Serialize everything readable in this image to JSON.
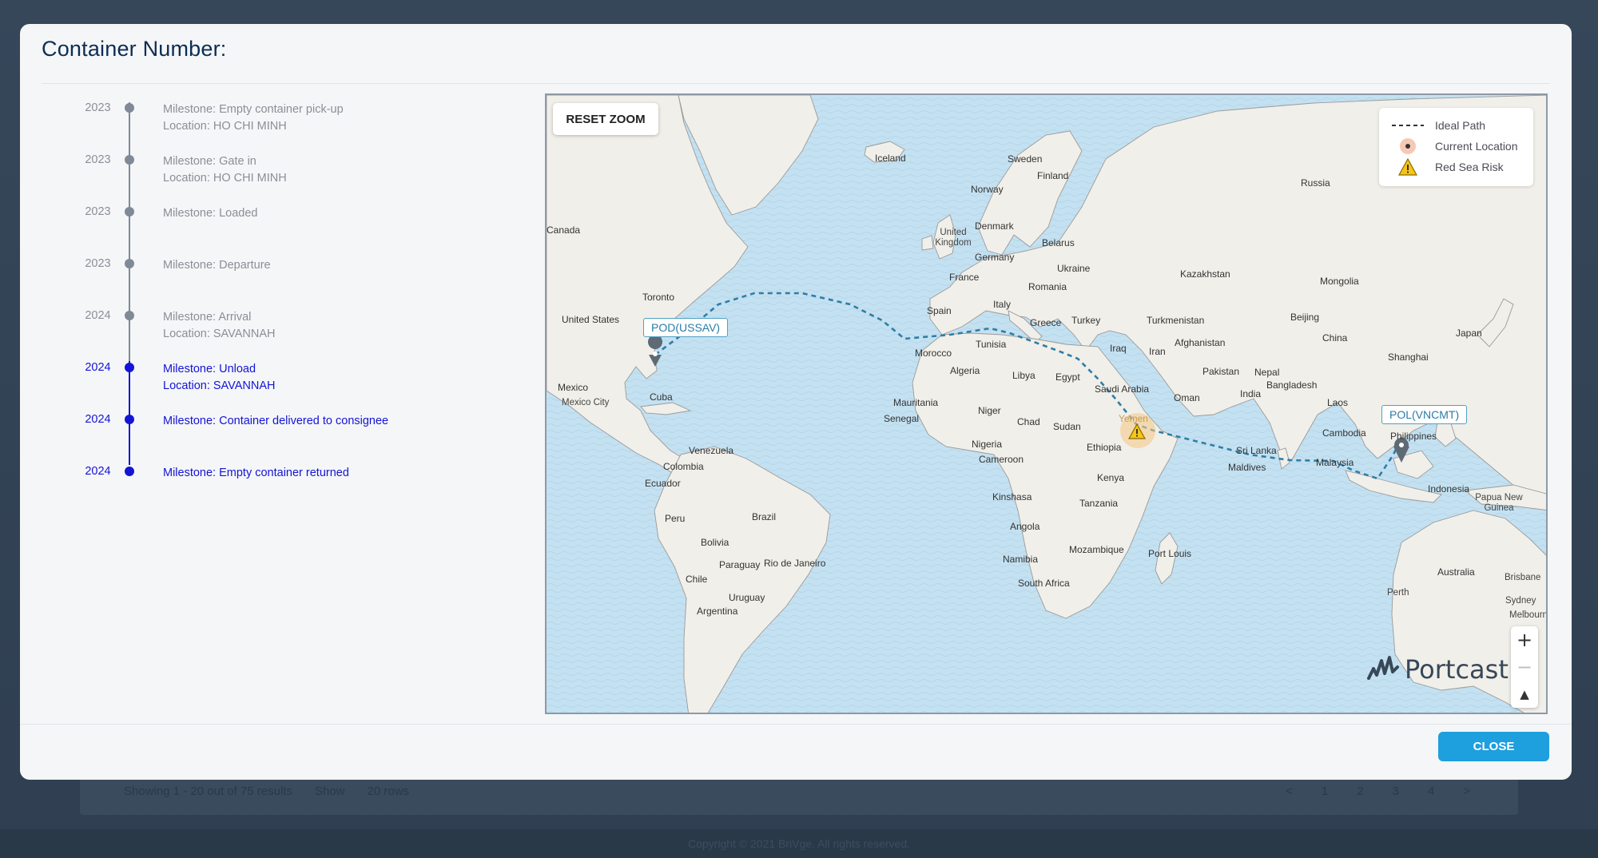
{
  "background": {
    "pager_text": "Showing 1 - 20 out of 75 results",
    "show_label": "Show",
    "rows_value": "20 rows",
    "pages": [
      "<",
      "1",
      "2",
      "3",
      "4",
      ">"
    ],
    "copyright": "Copyright © 2021 BriVge. All rights reserved."
  },
  "modal": {
    "title": "Container Number:",
    "close_label": "CLOSE"
  },
  "timeline": [
    {
      "year": "2023",
      "milestone": "Milestone: Empty container pick-up",
      "location": "Location: HO CHI MINH",
      "active": false
    },
    {
      "year": "2023",
      "milestone": "Milestone: Gate in",
      "location": "Location: HO CHI MINH",
      "active": false
    },
    {
      "year": "2023",
      "milestone": "Milestone: Loaded",
      "location": "",
      "active": false
    },
    {
      "year": "2023",
      "milestone": "Milestone: Departure",
      "location": "",
      "active": false
    },
    {
      "year": "2024",
      "milestone": "Milestone: Arrival",
      "location": "Location: SAVANNAH",
      "active": false
    },
    {
      "year": "2024",
      "milestone": "Milestone: Unload",
      "location": "Location: SAVANNAH",
      "active": true
    },
    {
      "year": "2024",
      "milestone": "Milestone: Container delivered to consignee",
      "location": "",
      "active": true
    },
    {
      "year": "2024",
      "milestone": "Milestone: Empty container returned",
      "location": "",
      "active": true
    }
  ],
  "map": {
    "reset_zoom_label": "RESET ZOOM",
    "legend": [
      {
        "label": "Ideal Path",
        "icon": "dashed-line-icon"
      },
      {
        "label": "Current Location",
        "icon": "current-location-icon"
      },
      {
        "label": "Red Sea Risk",
        "icon": "warning-icon"
      }
    ],
    "pod_label": "POD(USSAV)",
    "pol_label": "POL(VNCMT)",
    "risk_label": "Yemen",
    "brand": "Portcast",
    "zoom_in": "+",
    "zoom_out": "−",
    "compass": "▲",
    "water_color": "#c4e1f1",
    "land_color": "#f1efe9",
    "route_color": "#2f7ea6",
    "place_labels": [
      "Iceland",
      "Sweden",
      "Finland",
      "Norway",
      "Russia",
      "Canada",
      "United Kingdom",
      "Denmark",
      "Belarus",
      "Germany",
      "Ukraine",
      "Kazakhstan",
      "Mongolia",
      "France",
      "Romania",
      "Toronto",
      "Spain",
      "Italy",
      "United States",
      "Greece",
      "Turkey",
      "Turkmenistan",
      "Afghanistan",
      "Beijing",
      "Japan",
      "China",
      "Tunisia",
      "Iraq",
      "Iran",
      "Shanghai",
      "Morocco",
      "Algeria",
      "Libya",
      "Egypt",
      "Pakistan",
      "Nepal",
      "Bangladesh",
      "Mexico",
      "Saudi Arabia",
      "Oman",
      "India",
      "Mexico City",
      "Cuba",
      "Mauritania",
      "Niger",
      "Laos",
      "Senegal",
      "Chad",
      "Sudan",
      "Cambodia",
      "Philippines",
      "Nigeria",
      "Sri Lanka",
      "Venezuela",
      "Ethiopia",
      "Cameroon",
      "Maldives",
      "Malaysia",
      "Colombia",
      "Kenya",
      "Ecuador",
      "Kinshasa",
      "Indonesia",
      "Tanzania",
      "Papua New Guinea",
      "Brazil",
      "Peru",
      "Angola",
      "Bolivia",
      "Mozambique",
      "Port Louis",
      "Paraguay",
      "Rio de Janeiro",
      "Namibia",
      "Chile",
      "South Africa",
      "Australia",
      "Brisbane",
      "Uruguay",
      "Perth",
      "Sydney",
      "Argentina",
      "Melbourne"
    ]
  }
}
